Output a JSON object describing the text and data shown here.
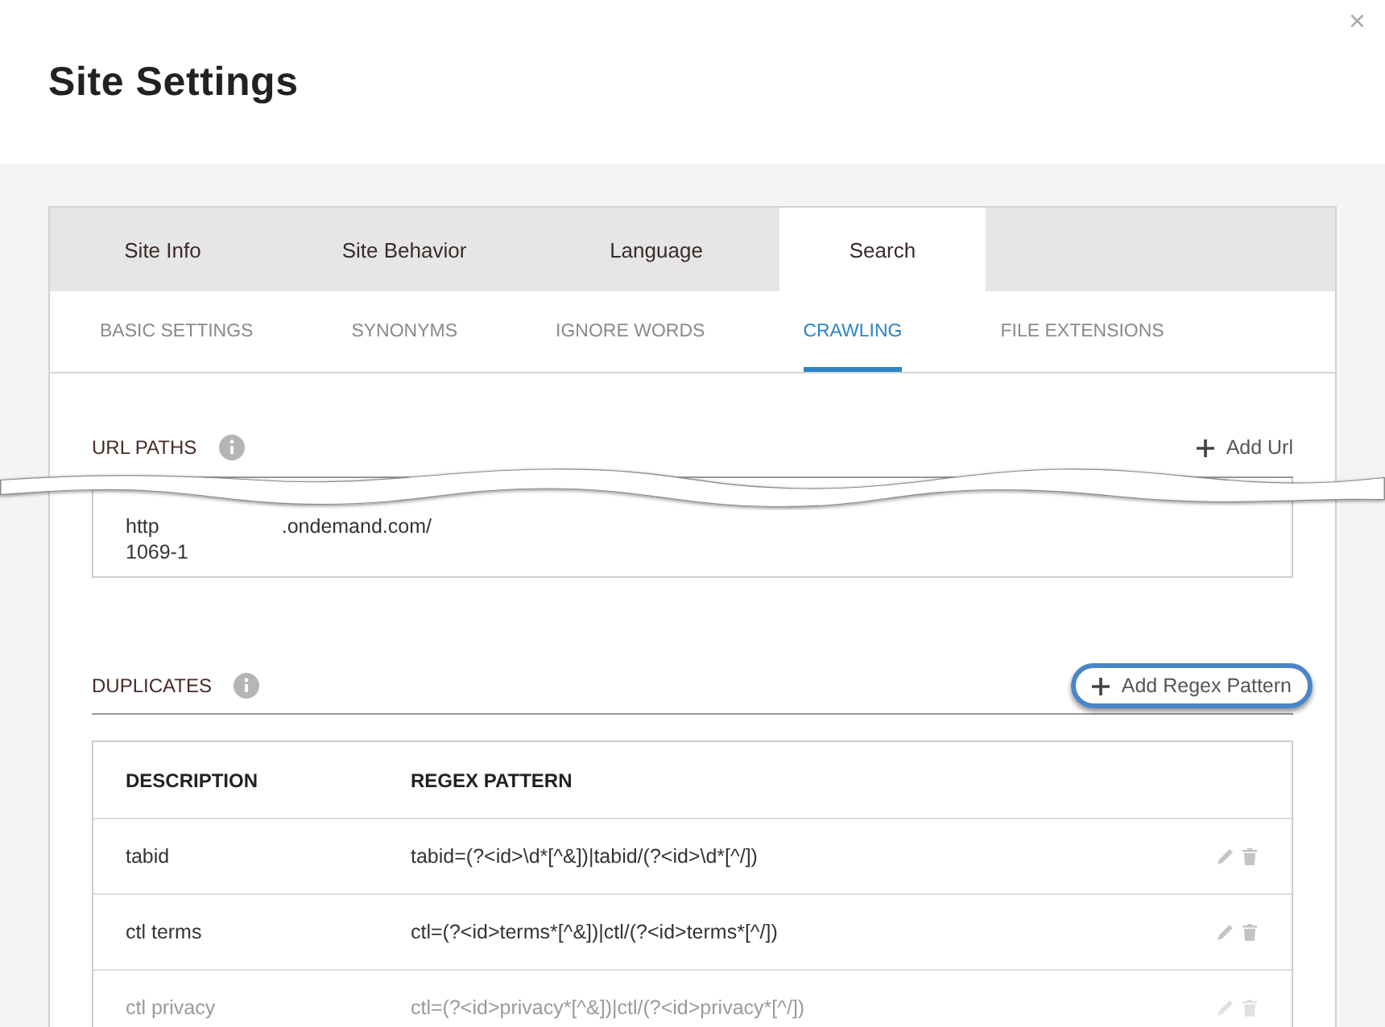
{
  "window": {
    "title": "Site Settings",
    "close_icon": "×"
  },
  "tabs": [
    {
      "label": "Site Info",
      "selected": false
    },
    {
      "label": "Site Behavior",
      "selected": false
    },
    {
      "label": "Language",
      "selected": false
    },
    {
      "label": "Search",
      "selected": true
    }
  ],
  "subtabs": [
    {
      "label": "BASIC SETTINGS",
      "selected": false
    },
    {
      "label": "SYNONYMS",
      "selected": false
    },
    {
      "label": "IGNORE WORDS",
      "selected": false
    },
    {
      "label": "CRAWLING",
      "selected": true
    },
    {
      "label": "FILE EXTENSIONS",
      "selected": false
    }
  ],
  "url_paths": {
    "title": "URL PATHS",
    "add_button": "Add Url",
    "entry_parts": [
      "http",
      ".ondemand.com/",
      "1069-1"
    ]
  },
  "duplicates": {
    "title": "DUPLICATES",
    "add_button": "Add Regex Pattern",
    "columns": [
      "DESCRIPTION",
      "REGEX PATTERN"
    ],
    "rows": [
      {
        "description": "tabid",
        "pattern": "tabid=(?<id>\\d*[^&])|tabid/(?<id>\\d*[^/])",
        "faded": false
      },
      {
        "description": "ctl terms",
        "pattern": "ctl=(?<id>terms*[^&])|ctl/(?<id>terms*[^/])",
        "faded": false
      },
      {
        "description": "ctl privacy",
        "pattern": "ctl=(?<id>privacy*[^&])|ctl/(?<id>privacy*[^/])",
        "faded": true
      }
    ]
  }
}
